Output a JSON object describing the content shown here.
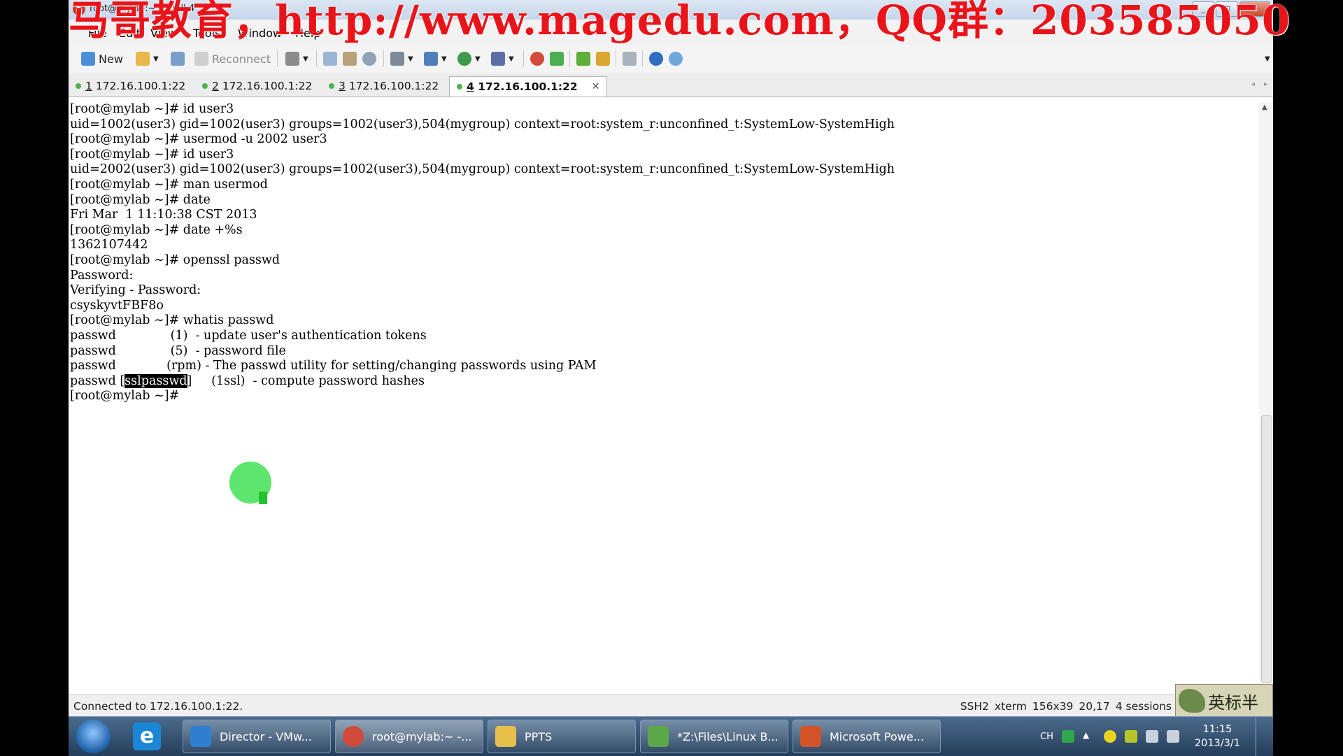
{
  "window": {
    "title": "root@mylab:~ - shell 4",
    "app_icon": "S",
    "buttons": {
      "minimize": "_",
      "maximize": "□",
      "close": "✕"
    }
  },
  "watermark": "马哥教育，http://www.magedu.com，QQ群：203585050",
  "menu": [
    "File",
    "Edit",
    "View",
    "Tools",
    "Window",
    "Help"
  ],
  "toolbar": {
    "new_label": "New",
    "reconnect_label": "Reconnect",
    "icons": [
      "new-session-icon",
      "open-folder-icon",
      "link-icon",
      "reconnect-icon",
      "properties-icon",
      "copy-icon",
      "paste-icon",
      "find-icon",
      "print-icon",
      "transfer-icon",
      "globe-icon",
      "keymap-icon",
      "sftp-icon",
      "check-icon",
      "tile-icon",
      "lock-icon",
      "keyboard-icon",
      "help-icon",
      "chat-icon"
    ]
  },
  "tabs": [
    {
      "num": "1",
      "host": "172.16.100.1:22",
      "active": false
    },
    {
      "num": "2",
      "host": "172.16.100.1:22",
      "active": false
    },
    {
      "num": "3",
      "host": "172.16.100.1:22",
      "active": false
    },
    {
      "num": "4",
      "host": "172.16.100.1:22",
      "active": true
    }
  ],
  "terminal": {
    "lines": [
      "[root@mylab ~]# id user3",
      "uid=1002(user3) gid=1002(user3) groups=1002(user3),504(mygroup) context=root:system_r:unconfined_t:SystemLow-SystemHigh",
      "[root@mylab ~]# usermod -u 2002 user3",
      "[root@mylab ~]# id user3",
      "uid=2002(user3) gid=1002(user3) groups=1002(user3),504(mygroup) context=root:system_r:unconfined_t:SystemLow-SystemHigh",
      "[root@mylab ~]# man usermod",
      "[root@mylab ~]# date",
      "Fri Mar  1 11:10:38 CST 2013",
      "[root@mylab ~]# date +%s",
      "1362107442",
      "[root@mylab ~]# openssl passwd",
      "Password:",
      "Verifying - Password:",
      "csyskyvtFBF8o",
      "[root@mylab ~]# whatis passwd",
      "passwd              (1)  - update user's authentication tokens",
      "passwd              (5)  - password file",
      "passwd             (rpm) - The passwd utility for setting/changing passwords using PAM"
    ],
    "last_line": {
      "pre": "passwd [",
      "selected": "sslpasswd",
      "post": "]     (1ssl)  - compute password hashes"
    },
    "prompt": "[root@mylab ~]# "
  },
  "status": {
    "connection": "Connected to 172.16.100.1:22.",
    "protocol": "SSH2",
    "terminal": "xterm",
    "size": "156x39",
    "cursor": "20,17",
    "sessions": "4 sessions"
  },
  "stamp_text": "英标半",
  "taskbar": {
    "items": [
      {
        "label": "Director - VMw...",
        "icon_color": "#2f7fd0"
      },
      {
        "label": "root@mylab:~ -...",
        "icon_color": "#d24a3a"
      },
      {
        "label": "PPTS",
        "icon_color": "#e7c04c"
      },
      {
        "label": "*Z:\\Files\\Linux B...",
        "icon_color": "#5aa84a"
      },
      {
        "label": "Microsoft Powe...",
        "icon_color": "#d2522a"
      }
    ],
    "tray_lang": "CH",
    "time": "11:15",
    "date": "2013/3/1"
  }
}
